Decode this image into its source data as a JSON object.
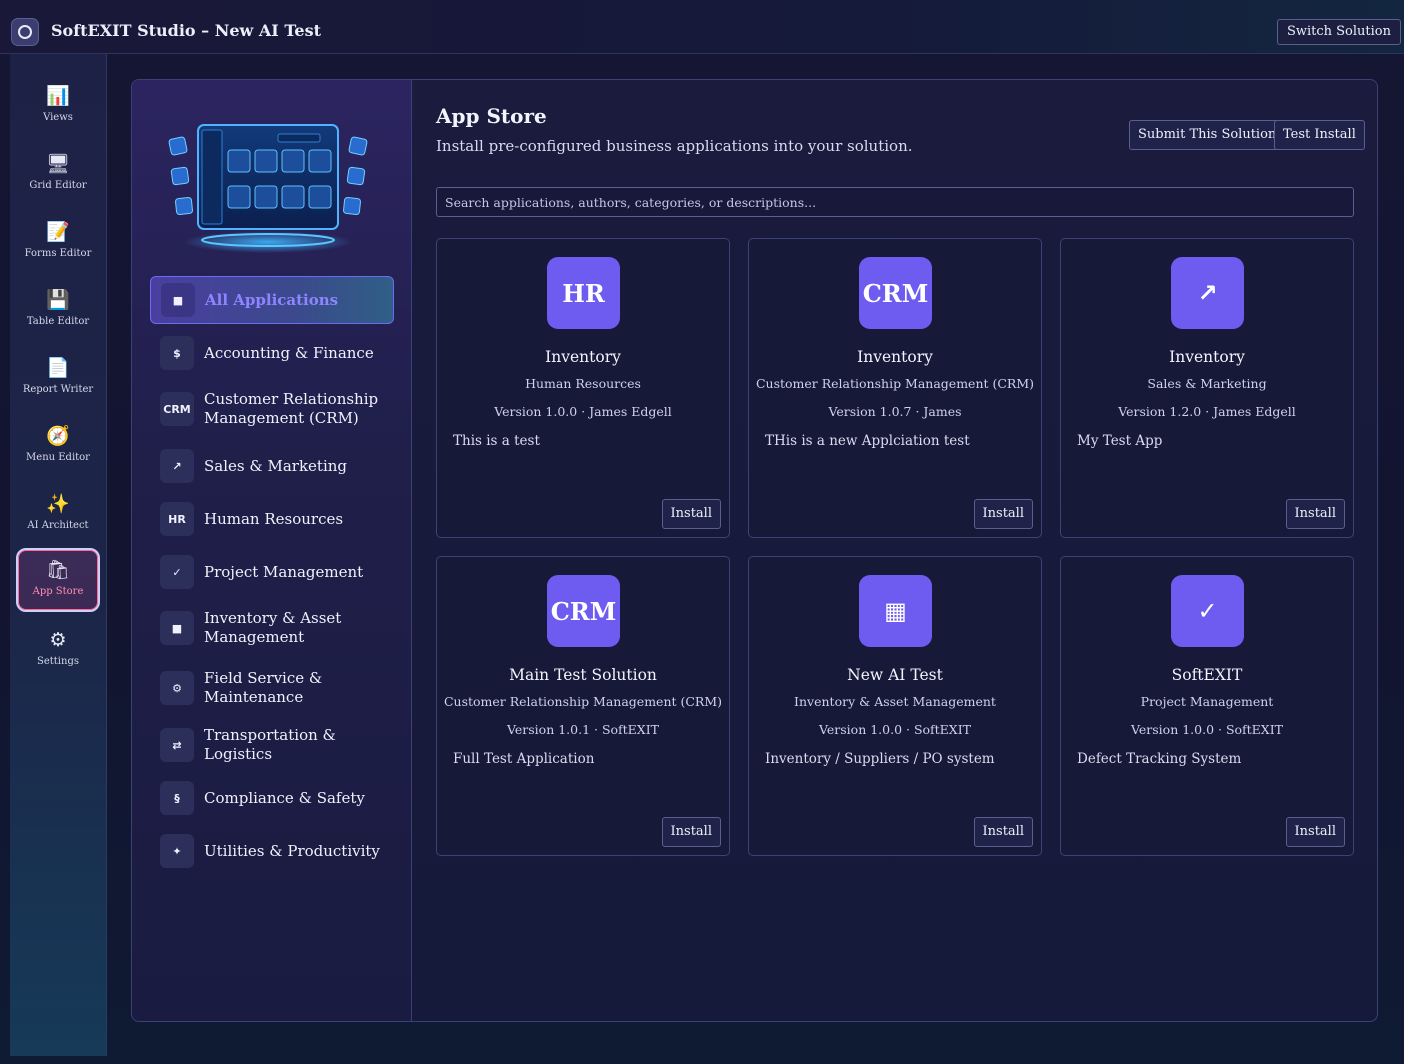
{
  "app": {
    "title": "SoftEXIT Studio – New AI Test",
    "switch_label": "Switch Solution"
  },
  "nav": [
    {
      "label": "Views",
      "icon": "📊",
      "icon_name": "bar-chart-icon"
    },
    {
      "label": "Grid Editor",
      "icon": "🖥",
      "icon_name": "monitor-icon"
    },
    {
      "label": "Forms Editor",
      "icon": "📝",
      "icon_name": "memo-icon"
    },
    {
      "label": "Table Editor",
      "icon": "💾",
      "icon_name": "floppy-disk-icon"
    },
    {
      "label": "Report Writer",
      "icon": "📄",
      "icon_name": "document-icon"
    },
    {
      "label": "Menu Editor",
      "icon": "🧭",
      "icon_name": "compass-icon"
    },
    {
      "label": "AI Architect",
      "icon": "✨",
      "icon_name": "sparkles-icon"
    },
    {
      "label": "App Store",
      "icon": "🛍",
      "icon_name": "shopping-bags-icon",
      "active": true
    },
    {
      "label": "Settings",
      "icon": "⚙",
      "icon_name": "gear-icon"
    }
  ],
  "categories": [
    {
      "label": "All Applications",
      "icon": "■",
      "active": true
    },
    {
      "label": "Accounting & Finance",
      "icon": "$"
    },
    {
      "label": "Customer Relationship Management (CRM)",
      "icon": "CRM"
    },
    {
      "label": "Sales & Marketing",
      "icon": "↗"
    },
    {
      "label": "Human Resources",
      "icon": "HR"
    },
    {
      "label": "Project Management",
      "icon": "✓"
    },
    {
      "label": "Inventory & Asset Management",
      "icon": "■"
    },
    {
      "label": "Field Service & Maintenance",
      "icon": "⚙"
    },
    {
      "label": "Transportation & Logistics",
      "icon": "⇄"
    },
    {
      "label": "Compliance & Safety",
      "icon": "§"
    },
    {
      "label": "Utilities & Productivity",
      "icon": "✦"
    }
  ],
  "store": {
    "title": "App Store",
    "subtitle": "Install pre-configured business applications into your solution.",
    "submit_label": "Submit This Solution",
    "test_install_label": "Test Install",
    "search_placeholder": "Search applications, authors, categories, or descriptions..."
  },
  "apps": [
    {
      "badge": "HR",
      "name": "Inventory",
      "category": "Human Resources",
      "version": "Version 1.0.0 · James Edgell",
      "description": "This is a test",
      "install_label": "Install"
    },
    {
      "badge": "CRM",
      "name": "Inventory",
      "category": "Customer Relationship Management (CRM)",
      "version": "Version 1.0.7 · James",
      "description": "THis is a new Applciation test",
      "install_label": "Install"
    },
    {
      "badge": "↗",
      "name": "Inventory",
      "category": "Sales & Marketing",
      "version": "Version 1.2.0 · James Edgell",
      "description": "My Test App",
      "install_label": "Install"
    },
    {
      "badge": "CRM",
      "name": "Main Test Solution",
      "category": "Customer Relationship Management (CRM)",
      "version": "Version 1.0.1 · SoftEXIT",
      "description": "Full Test Application",
      "install_label": "Install"
    },
    {
      "badge": "▦",
      "name": "New AI Test",
      "category": "Inventory & Asset Management",
      "version": "Version 1.0.0 · SoftEXIT",
      "description": "Inventory / Suppliers / PO system",
      "install_label": "Install"
    },
    {
      "badge": "✓",
      "name": "SoftEXIT",
      "category": "Project Management",
      "version": "Version 1.0.0 · SoftEXIT",
      "description": "Defect Tracking System",
      "install_label": "Install"
    }
  ],
  "colors": {
    "accent": "#6e5cf0",
    "background": "#151633",
    "active_nav_label": "#ff8fb0",
    "active_category_label": "#8f84ff"
  }
}
